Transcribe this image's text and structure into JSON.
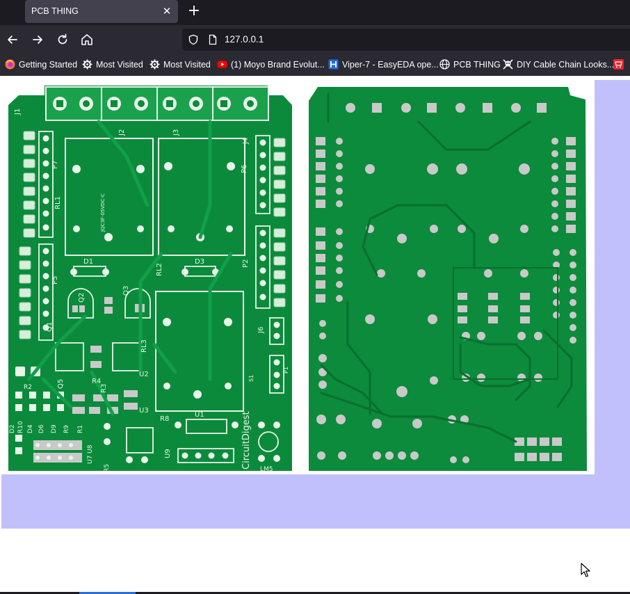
{
  "tab": {
    "title": "PCB THING",
    "close_icon": "close-icon"
  },
  "newtab_icon": "plus-icon",
  "nav": {
    "back_icon": "arrow-left-icon",
    "forward_icon": "arrow-right-icon",
    "reload_icon": "reload-icon",
    "home_icon": "home-icon",
    "url": "127.0.0.1"
  },
  "bookmarks": [
    {
      "label": "Getting Started",
      "icon": "firefox-icon"
    },
    {
      "label": "Most Visited",
      "icon": "gear-icon"
    },
    {
      "label": "Most Visited",
      "icon": "gear-icon"
    },
    {
      "label": "(1) Moyo Brand Evolut...",
      "icon": "youtube-icon"
    },
    {
      "label": "Viper-7 - EasyEDA ope...",
      "icon": "easyeda-icon"
    },
    {
      "label": "PCB THING",
      "icon": "globe-icon"
    },
    {
      "label": "DIY Cable Chain Looks...",
      "icon": "skull-icon"
    },
    {
      "label": "",
      "icon": "cart-icon"
    }
  ],
  "colors": {
    "page_bg": "#c2c0fc",
    "pcb_green": "#0c8a3c",
    "pcb_light": "#1aa14c",
    "chrome_dark": "#1c1b22",
    "chrome_mid": "#2b2a33"
  },
  "pcb_labels": {
    "j1": "J1",
    "j2": "J2",
    "j3": "J3",
    "j4": "J4",
    "p7": "P7",
    "p6": "P6",
    "p5": "P5",
    "p2": "P2",
    "p1": "P1",
    "rl1": "RL1",
    "rl2": "RL2",
    "rl3": "RL3",
    "q1": "Q1",
    "q2": "Q2",
    "q3": "Q3",
    "q5": "Q5",
    "d1": "D1",
    "d3": "D3",
    "r4": "R4",
    "r3": "R3",
    "u2": "U2",
    "u3": "U3",
    "r8": "R8",
    "u1": "U1",
    "j6": "J6",
    "u9": "U9",
    "d2": "D2",
    "r10": "R10",
    "d4": "D4",
    "d6": "D6",
    "d9": "D9",
    "r9": "R9",
    "r1": "R1",
    "r5": "R5",
    "u7u8": "U7 U8",
    "r2": "R2",
    "s1": "S1",
    "brand": "CircuitDigest",
    "lm5": "LM5",
    "relay_part": "JQC3F-05VDC-C"
  }
}
